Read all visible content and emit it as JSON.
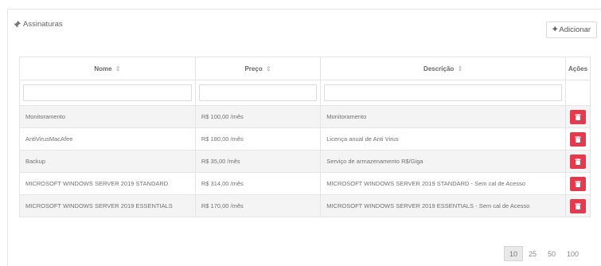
{
  "header": {
    "title": "Assinaturas",
    "add_label": "Adicionar"
  },
  "table": {
    "columns": [
      {
        "label": "Nome",
        "sort_glyph": "⇕"
      },
      {
        "label": "Preço",
        "sort_glyph": "⇕"
      },
      {
        "label": "Descrição",
        "sort_glyph": "⇕"
      },
      {
        "label": "Ações"
      }
    ],
    "rows": [
      {
        "nome": "Monitoramento",
        "preco": "R$ 100,00 /mês",
        "descricao": "Monitoramento"
      },
      {
        "nome": "AntiVirusMacAfee",
        "preco": "R$ 180,00 /mês",
        "descricao": "Licença anual de Anti Virus"
      },
      {
        "nome": "Backup",
        "preco": "R$ 35,00 /mês",
        "descricao": "Serviço de armazenamento R$/Giga"
      },
      {
        "nome": "MICROSOFT WINDOWS SERVER 2019 STANDARD",
        "preco": "R$ 314,00 /mês",
        "descricao": "MICROSOFT WINDOWS SERVER 2019 STANDARD - Sem cal de Acesso"
      },
      {
        "nome": "MICROSOFT WINDOWS SERVER 2019 ESSENTIALS",
        "preco": "R$ 170,00 /mês",
        "descricao": "MICROSOFT WINDOWS SERVER 2019 ESSENTIALS - Sem cal de Acesso"
      }
    ],
    "row_action_icon": "trash-icon",
    "action_color": "#e23a4f"
  },
  "pagination": {
    "options": [
      "10",
      "25",
      "50",
      "100"
    ],
    "selected": "10"
  }
}
